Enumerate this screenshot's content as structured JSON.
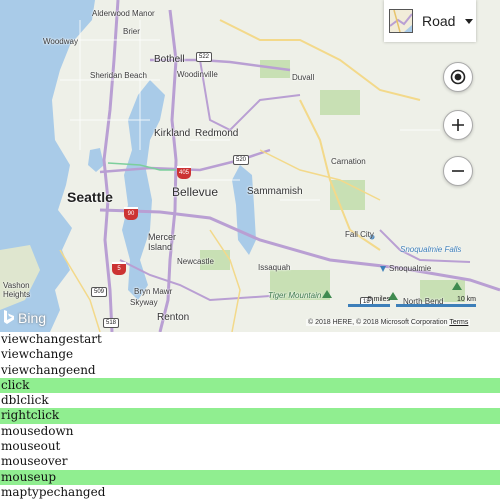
{
  "map": {
    "style_picker": {
      "label": "Road",
      "thumb_icon": "road-map-icon"
    },
    "buttons": {
      "locate_icon": "locate-me-icon",
      "zoom_in_icon": "plus-icon",
      "zoom_out_icon": "minus-icon"
    },
    "logo_text": "Bing",
    "scale": {
      "miles": "5 miles",
      "km": "10 km"
    },
    "copyright": "© 2018 HERE, © 2018 Microsoft Corporation",
    "terms": "Terms",
    "labels": {
      "alderwood_manor": "Alderwood Manor",
      "woodway": "Woodway",
      "brier": "Brier",
      "bothell": "Bothell",
      "sheridan_beach": "Sheridan Beach",
      "woodinville": "Woodinville",
      "duvall": "Duvall",
      "kirkland": "Kirkland",
      "redmond": "Redmond",
      "seattle": "Seattle",
      "bellevue": "Bellevue",
      "sammamish": "Sammamish",
      "carnation": "Carnation",
      "mercer_island": "Mercer\nIsland",
      "newcastle": "Newcastle",
      "issaquah": "Issaquah",
      "fall_city": "Fall City",
      "snoqualmie_falls": "Snoqualmie Falls",
      "snoqualmie": "Snoqualmie",
      "vashon_heights": "Vashon\nHeights",
      "bryn_mawr": "Bryn Mawr",
      "skyway": "Skyway",
      "renton": "Renton",
      "tiger_mountain": "Tiger Mountain",
      "north_bend": "North Bend"
    },
    "shields": {
      "s522": "522",
      "s520": "520",
      "s509": "509",
      "s518": "518",
      "s18": "18",
      "i405": "405",
      "i90": "90",
      "i5": "5"
    }
  },
  "events": [
    {
      "name": "viewchangestart",
      "highlighted": false
    },
    {
      "name": "viewchange",
      "highlighted": false
    },
    {
      "name": "viewchangeend",
      "highlighted": false
    },
    {
      "name": "click",
      "highlighted": true
    },
    {
      "name": "dblclick",
      "highlighted": false
    },
    {
      "name": "rightclick",
      "highlighted": true
    },
    {
      "name": "mousedown",
      "highlighted": false
    },
    {
      "name": "mouseout",
      "highlighted": false
    },
    {
      "name": "mouseover",
      "highlighted": false
    },
    {
      "name": "mouseup",
      "highlighted": true
    },
    {
      "name": "maptypechanged",
      "highlighted": false
    }
  ],
  "colors": {
    "highlight": "#90ee90",
    "water": "#a9cbe8",
    "land": "#eef0e8",
    "park": "#c8e0b4",
    "highway": "#b99fd3",
    "road": "#f3d98a"
  }
}
